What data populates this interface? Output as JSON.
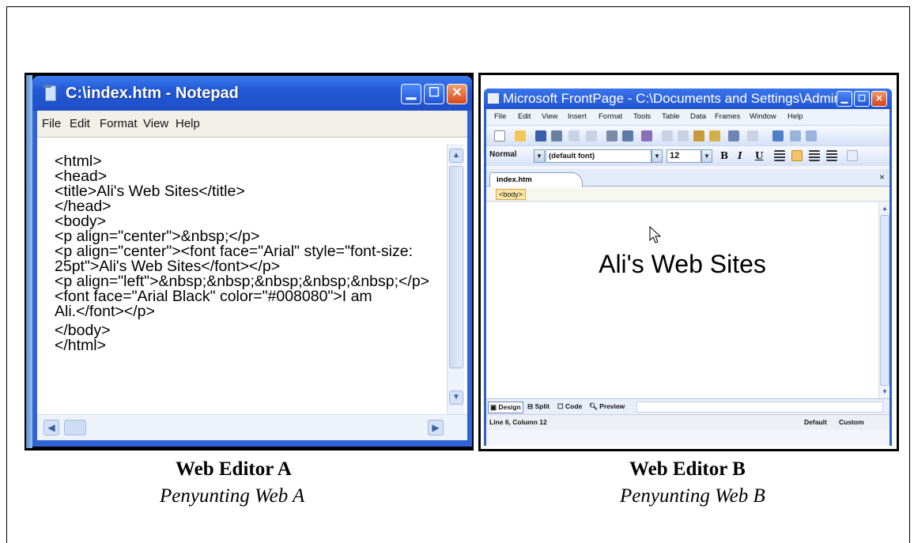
{
  "editor_a": {
    "title": "C:\\index.htm - Notepad",
    "menu": [
      "File",
      "Edit",
      "Format",
      "View",
      "Help"
    ],
    "code_lines": [
      "<html>",
      "<head>",
      "<title>Ali's Web Sites</title>",
      "</head>",
      "<body>",
      "<p align=\"center\">&nbsp;</p>",
      "<p align=\"center\"><font face=\"Arial\" style=\"font-size:",
      "25pt\">Ali's Web Sites</font></p>",
      "<p align=\"left\">&nbsp;&nbsp;&nbsp;&nbsp;&nbsp;</p>",
      "<font face=\"Arial Black\" color=\"#008080\">I am",
      "Ali.</font></p>",
      "</body>",
      "</html>"
    ],
    "caption": "Web Editor A",
    "caption_sub": "Penyunting Web A"
  },
  "editor_b": {
    "title": "Microsoft FrontPage - C:\\Documents and Settings\\Admin",
    "menu": [
      "File",
      "Edit",
      "View",
      "Insert",
      "Format",
      "Tools",
      "Table",
      "Data",
      "Frames",
      "Window",
      "Help"
    ],
    "style_value": "Normal",
    "font_value": "(default font)",
    "size_value": "12",
    "format_buttons": [
      "B",
      "I",
      "U"
    ],
    "tab_name": "index.htm",
    "tab_close": "×",
    "tag": "<body>",
    "heading": "Ali's Web Sites",
    "views": [
      "Design",
      "Split",
      "Code",
      "Preview"
    ],
    "status_left": "Line 6, Column 12",
    "status_default": "Default",
    "status_custom": "Custom",
    "caption": "Web Editor B",
    "caption_sub": "Penyunting Web B"
  },
  "colors": {
    "xp_blue": "#2f64d4",
    "close_red": "#d9481a",
    "tag_yellow": "#fbe6a6"
  }
}
